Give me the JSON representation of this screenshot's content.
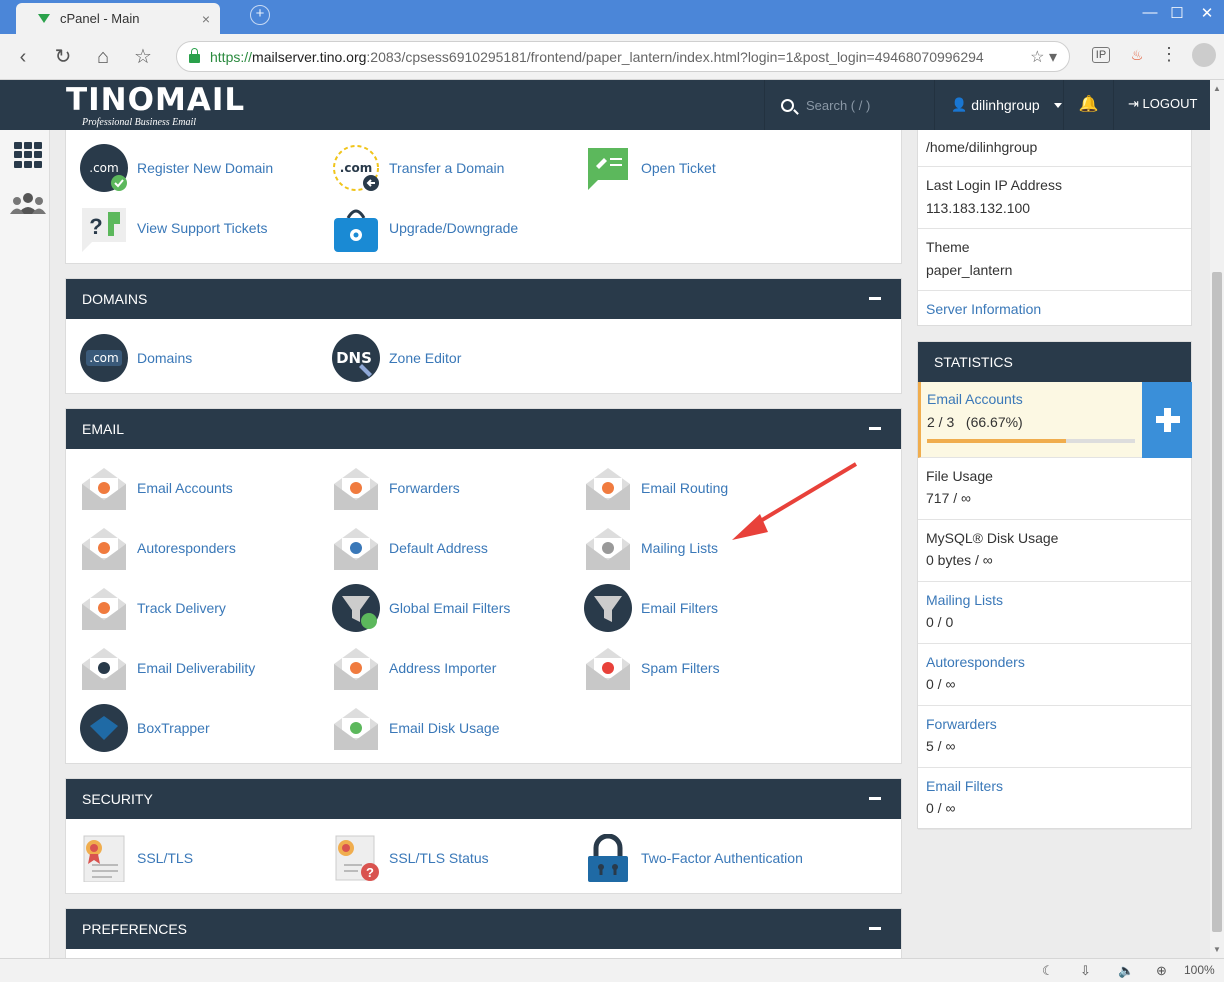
{
  "browser": {
    "tab_title": "cPanel - Main",
    "tab_close": "×",
    "url_https": "https://",
    "url_host": "mailserver.tino.org",
    "url_rest": ":2083/cpsess6910295181/frontend/paper_lantern/index.html?login=1&post_login=49468070996294",
    "zoom": "100%"
  },
  "header": {
    "logo_main": "TINOMAIL",
    "logo_sub": "Professional Business Email",
    "search_placeholder": "Search ( / )",
    "username": "dilinhgroup",
    "logout": "LOGOUT"
  },
  "top_items": [
    {
      "label": "Register New Domain",
      "icon": "register-domain-icon"
    },
    {
      "label": "Transfer a Domain",
      "icon": "transfer-domain-icon"
    },
    {
      "label": "Open Ticket",
      "icon": "open-ticket-icon"
    },
    {
      "label": "View Support Tickets",
      "icon": "support-tickets-icon"
    },
    {
      "label": "Upgrade/Downgrade",
      "icon": "upgrade-icon"
    }
  ],
  "domains": {
    "title": "DOMAINS",
    "items": [
      {
        "label": "Domains",
        "icon": "domains-icon"
      },
      {
        "label": "Zone Editor",
        "icon": "dns-icon"
      }
    ]
  },
  "email": {
    "title": "EMAIL",
    "items": [
      {
        "label": "Email Accounts"
      },
      {
        "label": "Forwarders"
      },
      {
        "label": "Email Routing"
      },
      {
        "label": "Autoresponders"
      },
      {
        "label": "Default Address"
      },
      {
        "label": "Mailing Lists"
      },
      {
        "label": "Track Delivery"
      },
      {
        "label": "Global Email Filters"
      },
      {
        "label": "Email Filters"
      },
      {
        "label": "Email Deliverability"
      },
      {
        "label": "Address Importer"
      },
      {
        "label": "Spam Filters"
      },
      {
        "label": "BoxTrapper"
      },
      {
        "label": "Email Disk Usage"
      }
    ]
  },
  "security": {
    "title": "SECURITY",
    "items": [
      {
        "label": "SSL/TLS"
      },
      {
        "label": "SSL/TLS Status"
      },
      {
        "label": "Two-Factor Authentication"
      }
    ]
  },
  "preferences": {
    "title": "PREFERENCES"
  },
  "general_info": {
    "home_dir": "/home/dilinhgroup",
    "last_login_label": "Last Login IP Address",
    "last_login_ip": "113.183.132.100",
    "theme_label": "Theme",
    "theme_value": "paper_lantern",
    "server_info": "Server Information"
  },
  "statistics": {
    "title": "STATISTICS",
    "email_accounts_label": "Email Accounts",
    "email_accounts_value": "2 / 3   (66.67%)",
    "email_accounts_fraction": 0.6667,
    "rows": [
      {
        "label": "File Usage",
        "value": "717 / ∞",
        "link": false
      },
      {
        "label": "MySQL® Disk Usage",
        "value": "0 bytes / ∞",
        "link": false
      },
      {
        "label": "Mailing Lists",
        "value": "0 / 0",
        "link": true
      },
      {
        "label": "Autoresponders",
        "value": "0 / ∞",
        "link": true
      },
      {
        "label": "Forwarders",
        "value": "5 / ∞",
        "link": true
      },
      {
        "label": "Email Filters",
        "value": "0 / ∞",
        "link": true
      }
    ]
  },
  "colors": {
    "header": "#293a4a",
    "link": "#3a78b8",
    "accent": "#3a8fd9",
    "warning": "#f0ad4e",
    "annotation_arrow": "#e8413a"
  }
}
